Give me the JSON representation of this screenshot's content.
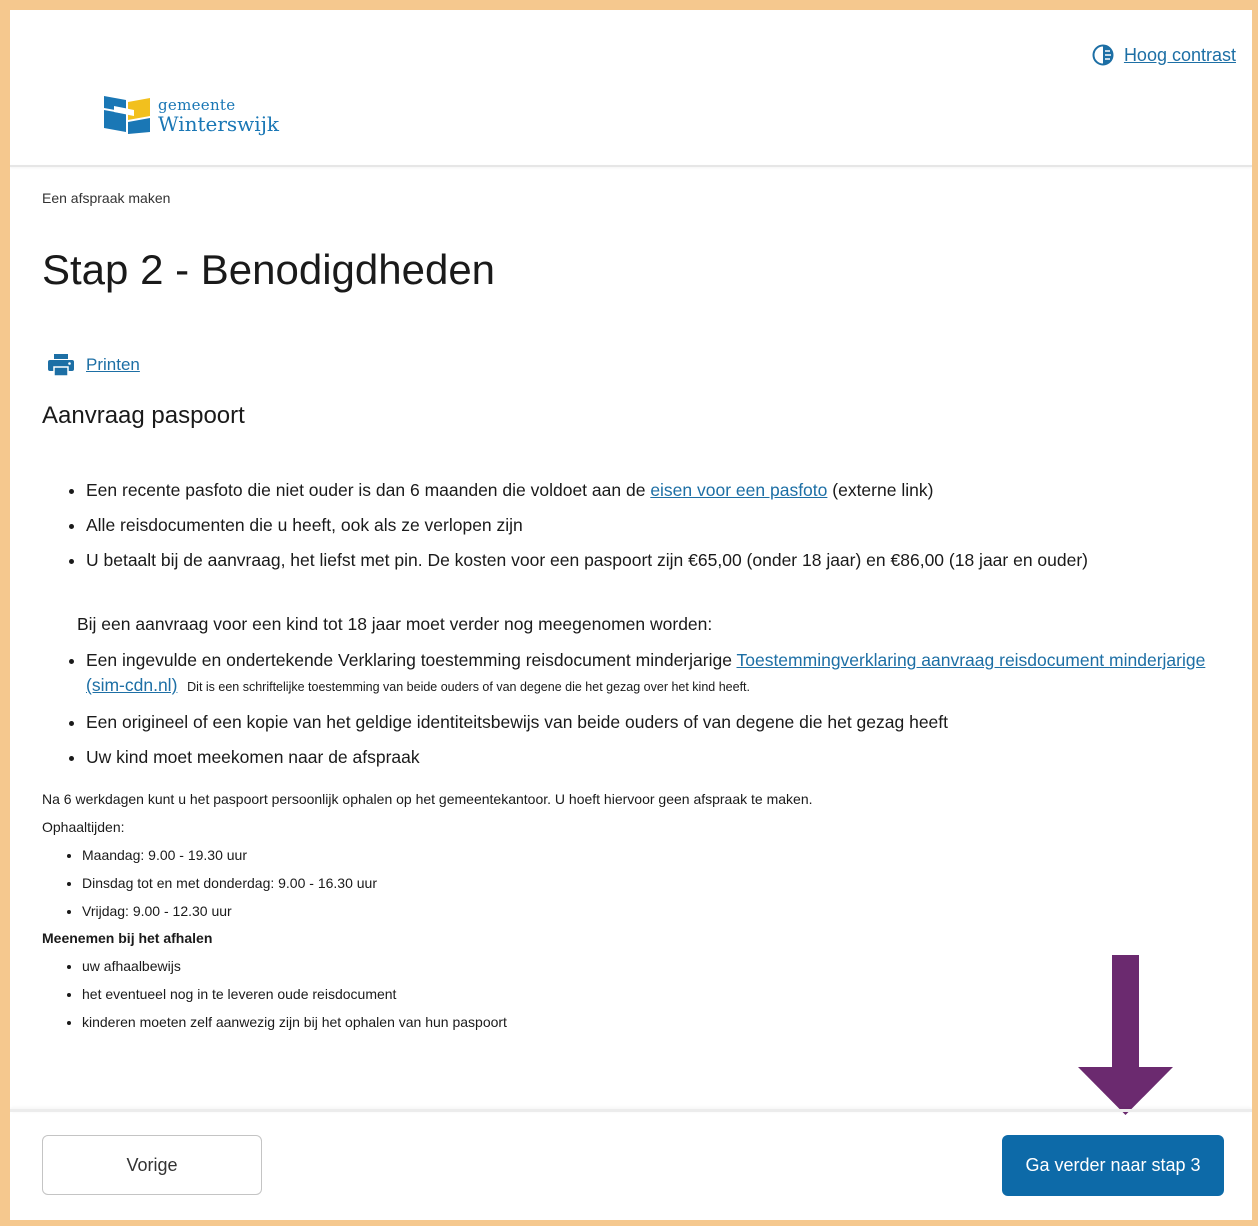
{
  "header": {
    "contrast_label": "Hoog contrast",
    "logo_small": "gemeente",
    "logo_big": "Winterswijk"
  },
  "breadcrumb": "Een afspraak maken",
  "page_title": "Stap 2 - Benodigdheden",
  "print_label": "Printen",
  "section_title": "Aanvraag paspoort",
  "requirements": {
    "item1_pre": "Een recente pasfoto die niet ouder is dan 6 maanden die voldoet aan de ",
    "item1_link": "eisen voor een pasfoto",
    "item1_post": " (externe link)",
    "item2": "Alle reisdocumenten die u heeft, ook als ze verlopen zijn",
    "item3": "U betaalt bij de aanvraag, het liefst met pin. De kosten voor een paspoort zijn €65,00  (onder 18 jaar) en €86,00  (18 jaar en ouder)"
  },
  "child": {
    "intro": "Bij een aanvraag voor een kind tot 18 jaar moet verder nog meegenomen worden:",
    "item1_pre": "Een ingevulde en ondertekende Verklaring toestemming reisdocument minderjarige ",
    "item1_link": "Toestemmingverklaring aanvraag reisdocument minderjarige (sim-cdn.nl)",
    "item1_note": "Dit is een schriftelijke toestemming van beide ouders of van degene die het gezag over het kind heeft.",
    "item2": "Een origineel of een kopie van het geldige identiteitsbewijs van beide ouders of van degene die het gezag heeft",
    "item3": "Uw kind moet meekomen naar de afspraak"
  },
  "pickup": {
    "info": "Na 6 werkdagen kunt u het paspoort persoonlijk ophalen op het gemeentekantoor. U hoeft hiervoor geen afspraak te maken.",
    "times_label": "Ophaaltijden:",
    "times": [
      "Maandag: 9.00 - 19.30 uur",
      "Dinsdag tot en met donderdag: 9.00 - 16.30 uur",
      "Vrijdag: 9.00 - 12.30 uur"
    ],
    "bring_label": "Meenemen bij het afhalen",
    "bring": [
      "uw afhaalbewijs",
      "het eventueel nog in te leveren oude reisdocument",
      "kinderen moeten zelf aanwezig zijn bij het ophalen van hun paspoort"
    ]
  },
  "footer": {
    "prev_label": "Vorige",
    "next_label": "Ga verder naar stap 3"
  },
  "colors": {
    "frame": "#f5c88e",
    "link": "#1d6fa5",
    "primary_button": "#0d6aa8",
    "arrow": "#6b2a6f"
  }
}
